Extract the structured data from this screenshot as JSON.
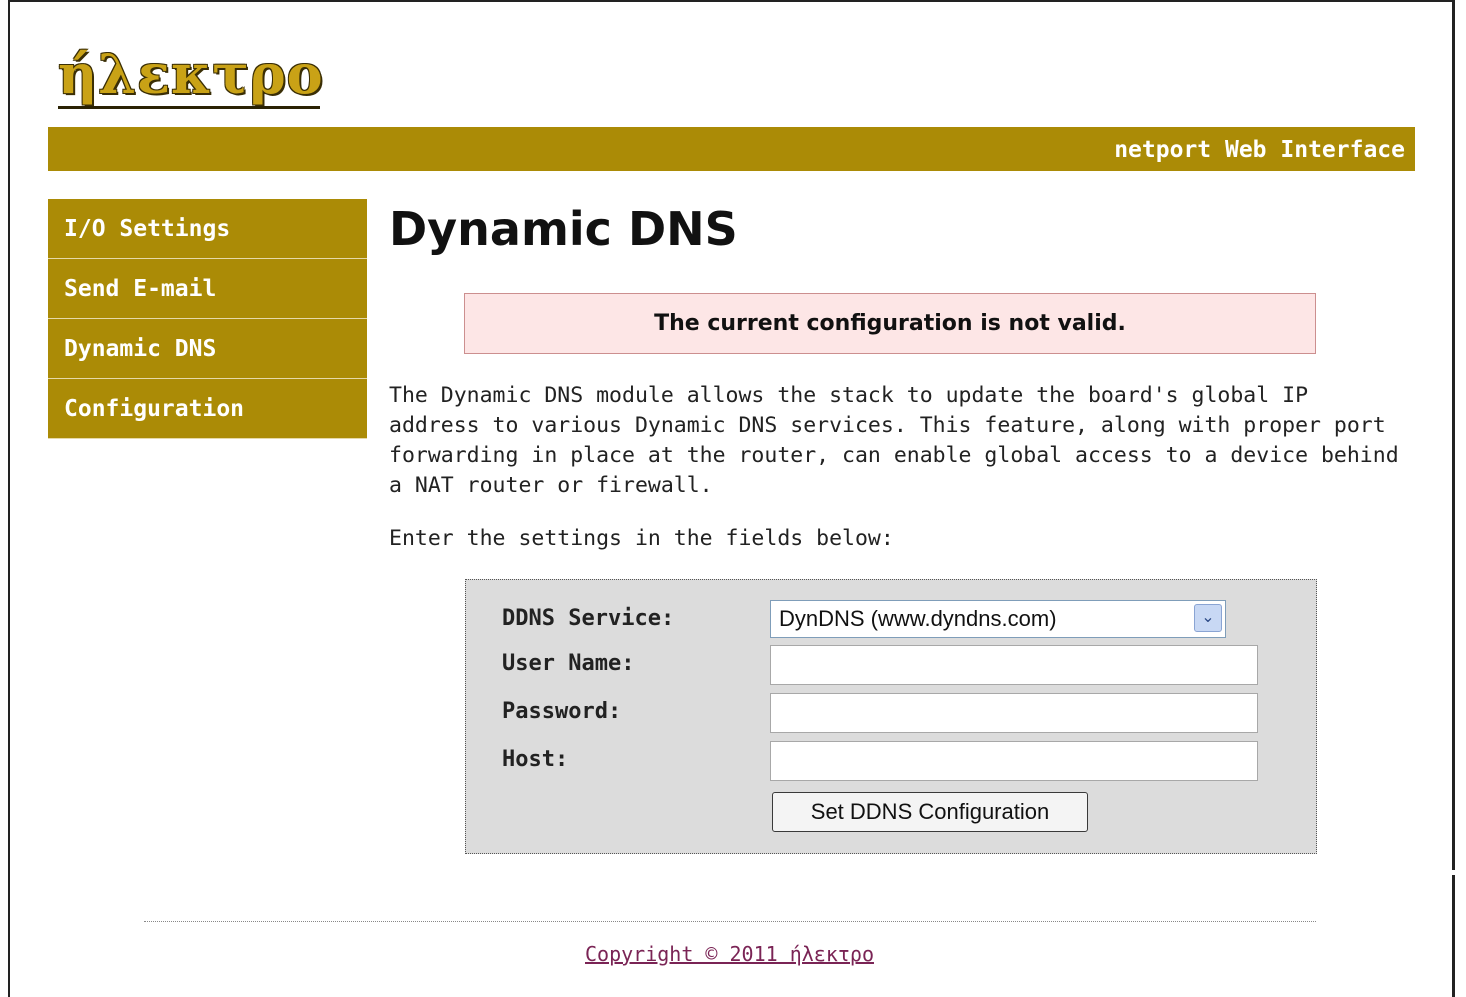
{
  "logo": {
    "text": "ήλεκτρο"
  },
  "banner": {
    "title": "netport Web Interface"
  },
  "sidebar": {
    "items": [
      {
        "label": "I/O Settings"
      },
      {
        "label": "Send E-mail"
      },
      {
        "label": "Dynamic DNS"
      },
      {
        "label": "Configuration"
      }
    ]
  },
  "main": {
    "title": "Dynamic DNS",
    "error": "The current configuration is not valid.",
    "description": "The Dynamic DNS module allows the stack to update the board's global IP address to various Dynamic DNS services. This feature, along with proper port forwarding in place at the router, can enable global access to a device behind a NAT router or firewall.",
    "prompt": "Enter the settings in the fields below:"
  },
  "form": {
    "service_label": "DDNS Service:",
    "service_value": "DynDNS (www.dyndns.com)",
    "user_label": "User Name:",
    "user_value": "",
    "password_label": "Password:",
    "password_value": "",
    "host_label": "Host:",
    "host_value": "",
    "submit_label": "Set DDNS Configuration"
  },
  "footer": {
    "copyright": "Copyright © 2011 ήλεκτρο"
  },
  "colors": {
    "accent": "#ab8b06",
    "logo": "#c9a216",
    "error_bg": "#fde6e6",
    "form_bg": "#dcdcdc",
    "link": "#7a2455"
  },
  "icons": {
    "select_arrow": "chevron-down-icon"
  }
}
